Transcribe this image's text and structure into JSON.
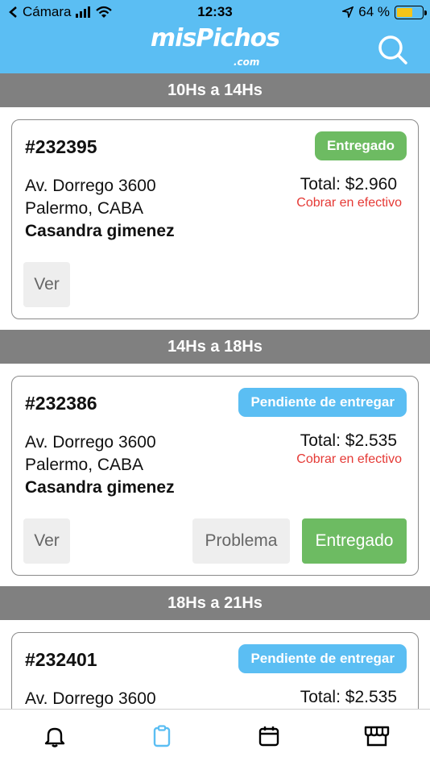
{
  "status_bar": {
    "carrier": "Cámara",
    "time": "12:33",
    "battery_percent": "64 %",
    "battery_level": 0.64
  },
  "header": {
    "logo_text": "misPichos",
    "logo_sub": ".com",
    "search_icon": "search-icon"
  },
  "colors": {
    "header_blue": "#5bbef3",
    "section_gray": "#808080",
    "delivered_green": "#6dbb62",
    "pending_blue": "#5bbef3",
    "cash_red": "#e53935"
  },
  "sections": [
    {
      "title": "10Hs a 14Hs",
      "order": {
        "id": "#232395",
        "status": "Entregado",
        "address_line1": "Av. Dorrego 3600",
        "address_line2": "Palermo, CABA",
        "customer": "Casandra gimenez",
        "total": "Total: $2.960",
        "payment_note": "Cobrar en efectivo",
        "view_label": "Ver"
      }
    },
    {
      "title": "14Hs a 18Hs",
      "order": {
        "id": "#232386",
        "status": "Pendiente de entregar",
        "address_line1": "Av. Dorrego 3600",
        "address_line2": "Palermo, CABA",
        "customer": "Casandra gimenez",
        "total": "Total: $2.535",
        "payment_note": "Cobrar en efectivo",
        "view_label": "Ver",
        "problem_label": "Problema",
        "delivered_label": "Entregado"
      }
    },
    {
      "title": "18Hs a 21Hs",
      "order": {
        "id": "#232401",
        "status": "Pendiente de entregar",
        "address_line1": "Av. Dorrego 3600",
        "total": "Total: $2.535"
      }
    }
  ],
  "tab_bar": {
    "tabs": [
      "bell-icon",
      "clipboard-icon",
      "calendar-icon",
      "store-icon"
    ],
    "active": "clipboard-icon"
  }
}
